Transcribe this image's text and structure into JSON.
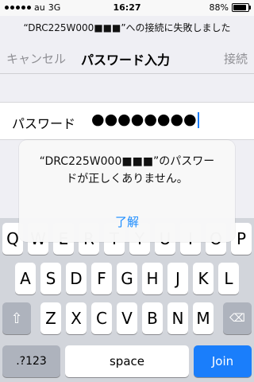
{
  "status_bar": {
    "carrier": "au",
    "network": "3G",
    "time": "16:27",
    "battery": "88%"
  },
  "prompt": "“DRC225W000■■■”への接続に失敗しました",
  "nav": {
    "cancel": "キャンセル",
    "title": "パスワード入力",
    "join": "接続"
  },
  "password": {
    "label": "パスワード",
    "value": "●●●●●●●●"
  },
  "alert": {
    "line1": "“DRC225W000■■■”のパスワー",
    "line2": "ドが正しくありません。",
    "ok": "了解"
  },
  "keyboard": {
    "row1": [
      "Q",
      "W",
      "E",
      "R",
      "T",
      "Y",
      "U",
      "I",
      "O",
      "P"
    ],
    "row2": [
      "A",
      "S",
      "D",
      "F",
      "G",
      "H",
      "J",
      "K",
      "L"
    ],
    "row3": [
      "Z",
      "X",
      "C",
      "V",
      "B",
      "N",
      "M"
    ],
    "shift_icon": "shift-arrow-icon",
    "delete_icon": "backspace-icon",
    "numbers": ".?123",
    "space": "space",
    "return": "Join"
  },
  "colors": {
    "accent": "#1a7efb",
    "alert_button": "#1a8cff"
  }
}
